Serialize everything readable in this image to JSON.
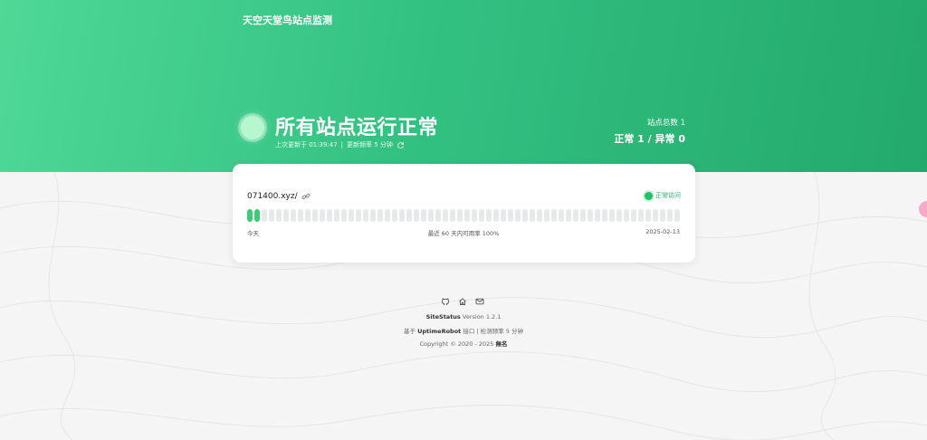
{
  "header": {
    "site_title": "天空天堂鸟站点监测",
    "heading": "所有站点运行正常",
    "last_updated": "上次更新于 01:39:47",
    "separator": "|",
    "frequency": "更新频率 5 分钟",
    "total_label": "站点总数 1",
    "total_value": "正常 1 / 异常 0",
    "status_color": "#b6f7cf"
  },
  "monitors": [
    {
      "name": "071400.xyz/",
      "status": "正常访问",
      "uptime_days": 60,
      "ok_days": 2,
      "left_label": "今天",
      "center_label": "最近 60 天内可用率 100%",
      "right_label": "2025-02-13",
      "ok_color": "#3ccc72",
      "empty_color": "#e6e8ea"
    }
  ],
  "footer": {
    "icons": [
      "github-icon",
      "home-icon",
      "mail-icon"
    ],
    "line1_app": "SiteStatus",
    "line1_version": "Version 1.2.1",
    "line2_prefix": "基于",
    "line2_api": "UptimeRobot",
    "line2_suffix": "接口 | 检测频率 5 分钟",
    "line3_copyright": "Copyright © 2020 - 2025",
    "line3_author": "無名"
  },
  "colors": {
    "hero_start": "#4fd897",
    "hero_end": "#23a96c",
    "accent": "#20b46a"
  }
}
